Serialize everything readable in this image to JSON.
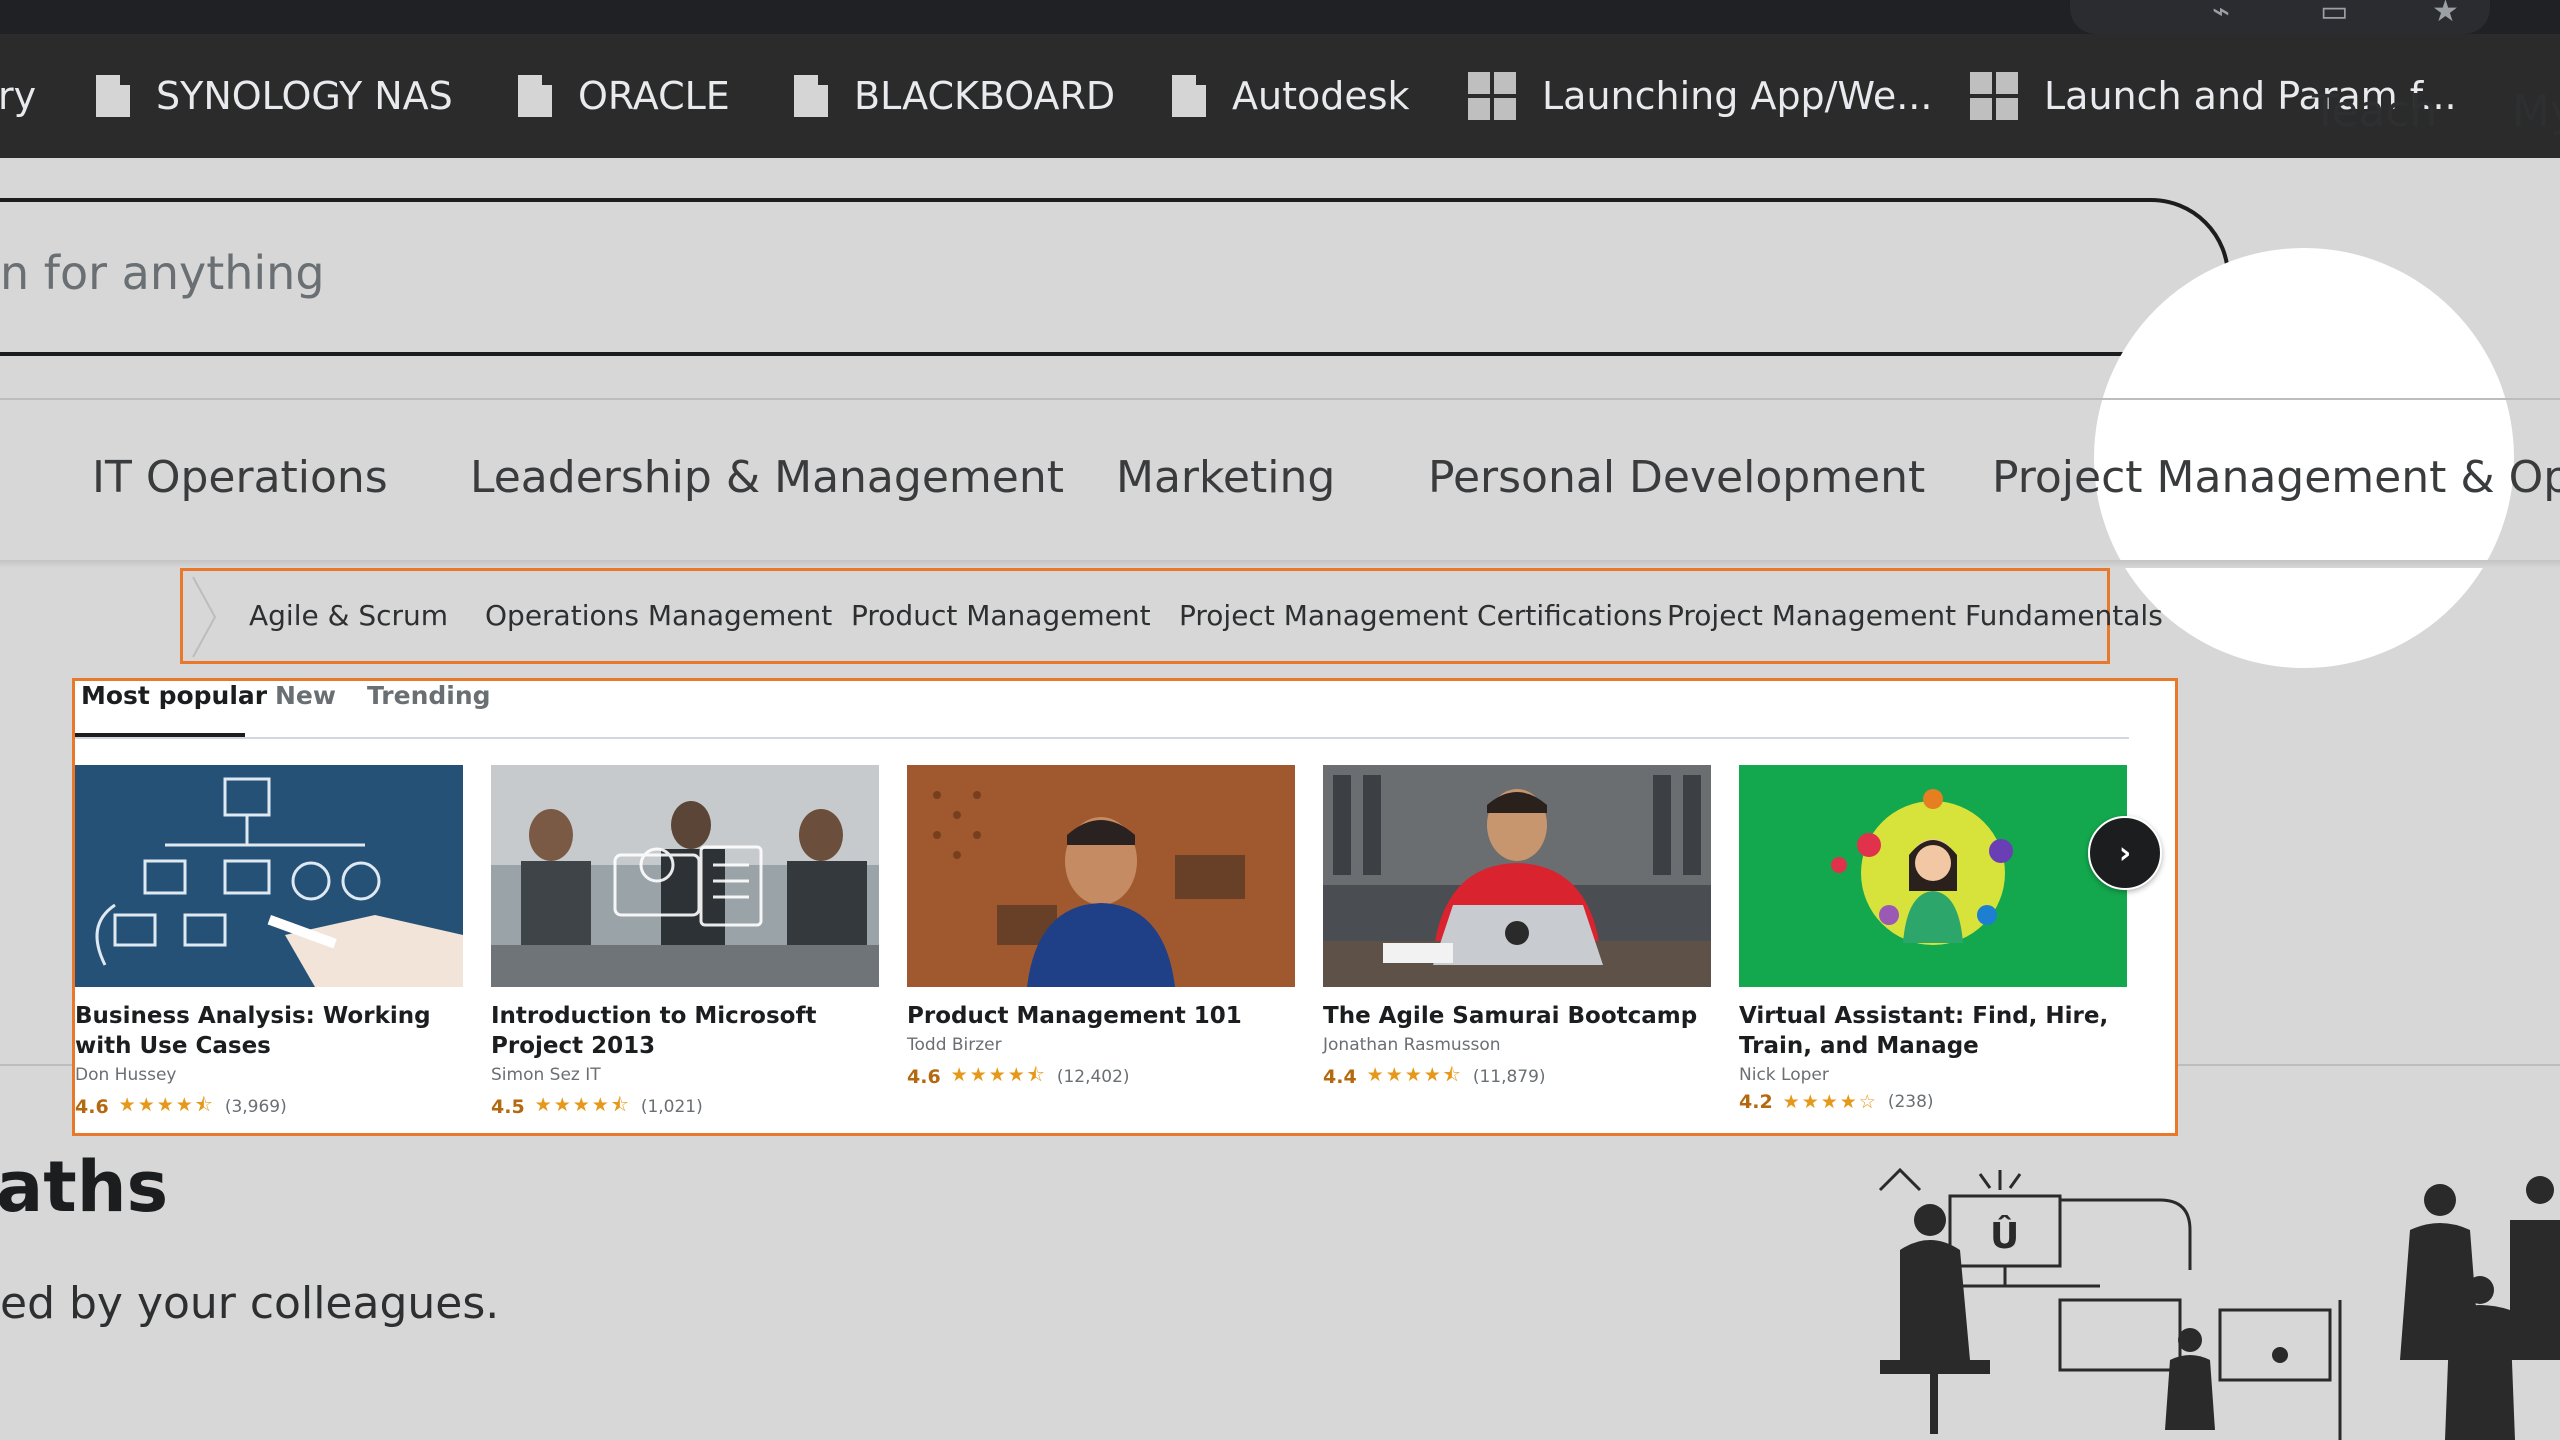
{
  "bookmarks": [
    {
      "label": "ry",
      "icon": "page-icon"
    },
    {
      "label": "SYNOLOGY NAS",
      "icon": "page-icon"
    },
    {
      "label": "ORACLE",
      "icon": "page-icon"
    },
    {
      "label": "BLACKBOARD",
      "icon": "page-icon"
    },
    {
      "label": "Autodesk",
      "icon": "page-icon"
    },
    {
      "label": "Launching App/We...",
      "icon": "grid-icon"
    },
    {
      "label": "Launch and Param f...",
      "icon": "grid-icon"
    }
  ],
  "header": {
    "search_placeholder": "n for anything",
    "teach_label": "Teach",
    "my_label": "My"
  },
  "categories": [
    "IT Operations",
    "Leadership & Management",
    "Marketing",
    "Personal Development",
    "Project Management & Oper"
  ],
  "subcategories": [
    "Agile & Scrum",
    "Operations Management",
    "Product Management",
    "Project Management Certifications",
    "Project Management Fundamentals"
  ],
  "tabs": [
    "Most popular",
    "New",
    "Trending"
  ],
  "courses": [
    {
      "title": "Business Analysis: Working with Use Cases",
      "author": "Don Hussey",
      "rating": "4.6",
      "stars": "★★★★⯪",
      "count": "(3,969)"
    },
    {
      "title": "Introduction to Microsoft Project 2013",
      "author": "Simon Sez IT",
      "rating": "4.5",
      "stars": "★★★★⯪",
      "count": "(1,021)"
    },
    {
      "title": "Product Management 101",
      "author": "Todd Birzer",
      "rating": "4.6",
      "stars": "★★★★⯪",
      "count": "(12,402)"
    },
    {
      "title": "The Agile Samurai Bootcamp",
      "author": "Jonathan Rasmusson",
      "rating": "4.4",
      "stars": "★★★★⯪",
      "count": "(11,879)"
    },
    {
      "title": "Virtual Assistant: Find, Hire, Train, and Manage",
      "author": "Nick Loper",
      "rating": "4.2",
      "stars": "★★★★☆",
      "count": "(238)"
    }
  ],
  "section": {
    "title": "aths",
    "subtitle": "ed by your colleagues."
  },
  "colors": {
    "accent_orange": "#e8782a",
    "rating_color": "#b4690e",
    "star_color": "#e59819"
  }
}
